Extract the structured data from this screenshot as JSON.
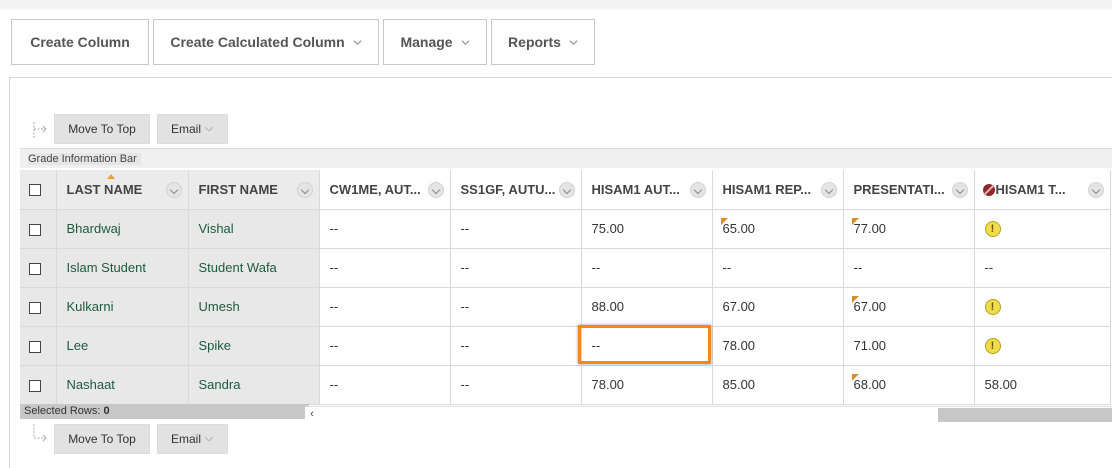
{
  "toolbar": {
    "create_column": "Create Column",
    "create_calculated_column": "Create Calculated Column",
    "manage": "Manage",
    "reports": "Reports"
  },
  "actions": {
    "move_to_top": "Move To Top",
    "email": "Email"
  },
  "info_bar": "Grade Information Bar",
  "columns": [
    "LAST NAME",
    "FIRST NAME",
    "CW1ME, AUT...",
    "SS1GF, AUTU...",
    "HISAM1 AUT...",
    "HISAM1 REP...",
    "PRESENTATI...",
    "HISAM1 T..."
  ],
  "rows": [
    {
      "last": "Bhardwaj",
      "first": "Vishal",
      "c1": "--",
      "c2": "--",
      "c3": "75.00",
      "c4": "65.00",
      "c5": "77.00",
      "c6": "!"
    },
    {
      "last": "Islam Student",
      "first": "Student Wafa",
      "c1": "--",
      "c2": "--",
      "c3": "--",
      "c4": "--",
      "c5": "--",
      "c6": "--"
    },
    {
      "last": "Kulkarni",
      "first": "Umesh",
      "c1": "--",
      "c2": "--",
      "c3": "88.00",
      "c4": "67.00",
      "c5": "67.00",
      "c6": "!"
    },
    {
      "last": "Lee",
      "first": "Spike",
      "c1": "--",
      "c2": "--",
      "c3": "--",
      "c4": "78.00",
      "c5": "71.00",
      "c6": "!"
    },
    {
      "last": "Nashaat",
      "first": "Sandra",
      "c1": "--",
      "c2": "--",
      "c3": "78.00",
      "c4": "85.00",
      "c5": "68.00",
      "c6": "58.00"
    }
  ],
  "selected_rows_label": "Selected Rows:",
  "selected_rows_count": "0",
  "colors": {
    "accent_highlight": "#f08a1c",
    "grade_text": "#1d5a43",
    "flag": "#d98d2c"
  }
}
